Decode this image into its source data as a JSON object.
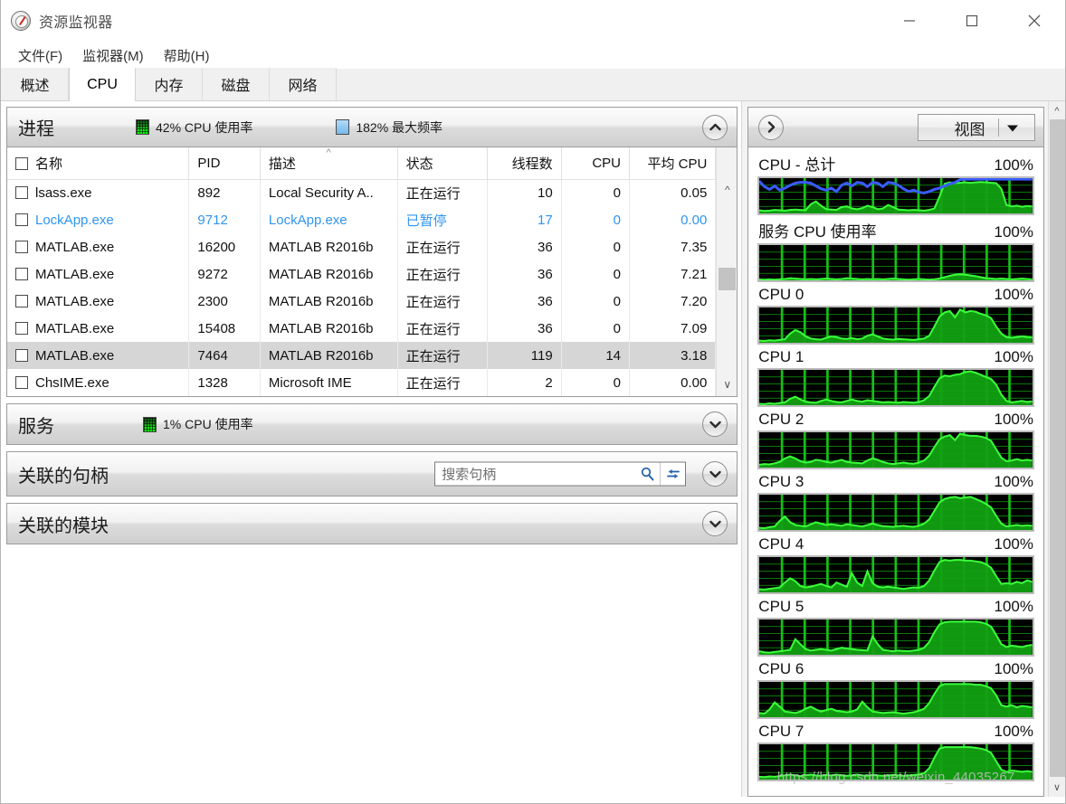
{
  "window": {
    "title": "资源监视器",
    "app_icon": "resource-monitor-icon",
    "controls": {
      "minimize": "minimize-icon",
      "maximize": "maximize-icon",
      "close": "close-icon"
    }
  },
  "menubar": {
    "items": [
      "文件(F)",
      "监视器(M)",
      "帮助(H)"
    ]
  },
  "tabs": {
    "items": [
      {
        "label": "概述",
        "active": false
      },
      {
        "label": "CPU",
        "active": true
      },
      {
        "label": "内存",
        "active": false
      },
      {
        "label": "磁盘",
        "active": false
      },
      {
        "label": "网络",
        "active": false
      }
    ]
  },
  "processes_section": {
    "title": "进程",
    "legend": [
      {
        "swatch": "green",
        "text": "42% CPU 使用率"
      },
      {
        "swatch": "blue",
        "text": "182% 最大频率"
      }
    ],
    "collapse_icon": "chevron-up-icon",
    "columns": [
      {
        "key": "name",
        "label": "名称",
        "align": "l"
      },
      {
        "key": "pid",
        "label": "PID",
        "align": "l"
      },
      {
        "key": "desc",
        "label": "描述",
        "align": "l",
        "sorted": "asc"
      },
      {
        "key": "status",
        "label": "状态",
        "align": "l"
      },
      {
        "key": "threads",
        "label": "线程数",
        "align": "r"
      },
      {
        "key": "cpu",
        "label": "CPU",
        "align": "r"
      },
      {
        "key": "avgcpu",
        "label": "平均 CPU",
        "align": "r"
      }
    ],
    "rows": [
      {
        "name": "lsass.exe",
        "pid": "892",
        "desc": "Local Security A..",
        "status": "正在运行",
        "threads": "10",
        "cpu": "0",
        "avgcpu": "0.05",
        "state": "normal"
      },
      {
        "name": "LockApp.exe",
        "pid": "9712",
        "desc": "LockApp.exe",
        "status": "已暂停",
        "threads": "17",
        "cpu": "0",
        "avgcpu": "0.00",
        "state": "suspended"
      },
      {
        "name": "MATLAB.exe",
        "pid": "16200",
        "desc": "MATLAB R2016b",
        "status": "正在运行",
        "threads": "36",
        "cpu": "0",
        "avgcpu": "7.35",
        "state": "normal"
      },
      {
        "name": "MATLAB.exe",
        "pid": "9272",
        "desc": "MATLAB R2016b",
        "status": "正在运行",
        "threads": "36",
        "cpu": "0",
        "avgcpu": "7.21",
        "state": "normal"
      },
      {
        "name": "MATLAB.exe",
        "pid": "2300",
        "desc": "MATLAB R2016b",
        "status": "正在运行",
        "threads": "36",
        "cpu": "0",
        "avgcpu": "7.20",
        "state": "normal"
      },
      {
        "name": "MATLAB.exe",
        "pid": "15408",
        "desc": "MATLAB R2016b",
        "status": "正在运行",
        "threads": "36",
        "cpu": "0",
        "avgcpu": "7.09",
        "state": "normal"
      },
      {
        "name": "MATLAB.exe",
        "pid": "7464",
        "desc": "MATLAB R2016b",
        "status": "正在运行",
        "threads": "119",
        "cpu": "14",
        "avgcpu": "3.18",
        "state": "selected"
      },
      {
        "name": "ChsIME.exe",
        "pid": "1328",
        "desc": "Microsoft IME",
        "status": "正在运行",
        "threads": "2",
        "cpu": "0",
        "avgcpu": "0.00",
        "state": "normal"
      }
    ]
  },
  "services_section": {
    "title": "服务",
    "legend": [
      {
        "swatch": "green",
        "text": "1% CPU 使用率"
      }
    ],
    "expand_icon": "chevron-down-icon"
  },
  "handles_section": {
    "title": "关联的句柄",
    "search_placeholder": "搜索句柄",
    "search_value": "",
    "search_icon": "search-icon",
    "refresh_icon": "refresh-arrows-icon",
    "expand_icon": "chevron-down-icon"
  },
  "modules_section": {
    "title": "关联的模块",
    "expand_icon": "chevron-down-icon"
  },
  "graph_panel": {
    "expand_icon": "chevron-right-icon",
    "view_label": "视图",
    "dropdown_icon": "triangle-down-icon"
  },
  "watermark": "https://blog.csdn.net/weixin_44035267",
  "chart_data": [
    {
      "type": "area",
      "title": "CPU - 总计",
      "scale_label": "100%",
      "ylim": [
        0,
        100
      ],
      "grid": true,
      "series": [
        {
          "name": "CPU 使用率",
          "color": "#00e000",
          "values": [
            9,
            7,
            8,
            10,
            9,
            8,
            10,
            11,
            10,
            9,
            26,
            34,
            22,
            12,
            11,
            10,
            18,
            20,
            14,
            12,
            15,
            22,
            18,
            12,
            14,
            24,
            18,
            11,
            10,
            9,
            10,
            9,
            8,
            10,
            14,
            48,
            84,
            88,
            86,
            87,
            88,
            87,
            88,
            89,
            88,
            87,
            86,
            70,
            24,
            20,
            22,
            19,
            21,
            20
          ]
        },
        {
          "name": "最大频率",
          "color": "#3a5cff",
          "values": [
            92,
            76,
            68,
            78,
            66,
            72,
            80,
            86,
            88,
            88,
            86,
            78,
            70,
            66,
            72,
            62,
            80,
            86,
            78,
            88,
            86,
            76,
            88,
            86,
            76,
            88,
            86,
            80,
            70,
            62,
            66,
            60,
            58,
            62,
            68,
            72,
            78,
            84,
            88,
            96,
            97,
            97,
            97,
            97,
            97,
            97,
            97,
            97,
            97,
            97,
            97,
            97,
            97,
            97
          ]
        }
      ]
    },
    {
      "type": "area",
      "title": "服务 CPU 使用率",
      "scale_label": "100%",
      "ylim": [
        0,
        100
      ],
      "grid": true,
      "series": [
        {
          "name": "服务 CPU",
          "color": "#00e000",
          "values": [
            3,
            2,
            3,
            2,
            3,
            4,
            6,
            5,
            4,
            3,
            4,
            3,
            4,
            5,
            4,
            3,
            4,
            6,
            5,
            4,
            3,
            4,
            3,
            4,
            3,
            4,
            5,
            4,
            3,
            2,
            3,
            4,
            3,
            2,
            3,
            5,
            9,
            13,
            16,
            17,
            16,
            14,
            12,
            9,
            6,
            5,
            4,
            5,
            4,
            3,
            4,
            5,
            4,
            3
          ]
        }
      ]
    },
    {
      "type": "area",
      "title": "CPU 0",
      "scale_label": "100%",
      "ylim": [
        0,
        100
      ],
      "grid": true,
      "series": [
        {
          "name": "CPU 0",
          "color": "#00e000",
          "values": [
            6,
            5,
            7,
            6,
            8,
            10,
            26,
            36,
            30,
            18,
            12,
            10,
            9,
            14,
            18,
            16,
            12,
            11,
            13,
            10,
            12,
            20,
            24,
            18,
            12,
            10,
            9,
            11,
            10,
            9,
            8,
            10,
            12,
            20,
            46,
            74,
            86,
            90,
            72,
            94,
            86,
            90,
            88,
            82,
            78,
            70,
            46,
            26,
            16,
            14,
            16,
            18,
            16,
            15
          ]
        }
      ]
    },
    {
      "type": "area",
      "title": "CPU 1",
      "scale_label": "100%",
      "ylim": [
        0,
        100
      ],
      "grid": true,
      "series": [
        {
          "name": "CPU 1",
          "color": "#00e000",
          "values": [
            4,
            3,
            5,
            4,
            6,
            8,
            18,
            24,
            16,
            10,
            8,
            7,
            12,
            16,
            12,
            9,
            8,
            12,
            16,
            12,
            10,
            14,
            12,
            10,
            8,
            9,
            8,
            7,
            9,
            8,
            7,
            9,
            14,
            26,
            52,
            76,
            84,
            82,
            86,
            88,
            94,
            96,
            92,
            86,
            80,
            74,
            58,
            30,
            12,
            8,
            10,
            12,
            9,
            11
          ]
        }
      ]
    },
    {
      "type": "area",
      "title": "CPU 2",
      "scale_label": "100%",
      "ylim": [
        0,
        100
      ],
      "grid": true,
      "series": [
        {
          "name": "CPU 2",
          "color": "#00e000",
          "values": [
            8,
            10,
            9,
            12,
            16,
            26,
            32,
            26,
            18,
            14,
            16,
            22,
            20,
            16,
            14,
            18,
            22,
            16,
            14,
            13,
            12,
            20,
            26,
            22,
            16,
            12,
            10,
            12,
            14,
            12,
            11,
            14,
            20,
            34,
            58,
            80,
            88,
            92,
            78,
            96,
            92,
            90,
            90,
            88,
            84,
            76,
            52,
            28,
            18,
            20,
            24,
            20,
            22,
            20
          ]
        }
      ]
    },
    {
      "type": "area",
      "title": "CPU 3",
      "scale_label": "100%",
      "ylim": [
        0,
        100
      ],
      "grid": true,
      "series": [
        {
          "name": "CPU 3",
          "color": "#00e000",
          "values": [
            6,
            5,
            8,
            10,
            26,
            38,
            22,
            14,
            12,
            10,
            16,
            22,
            18,
            14,
            16,
            14,
            12,
            16,
            14,
            12,
            10,
            14,
            18,
            14,
            11,
            10,
            9,
            11,
            12,
            10,
            9,
            12,
            18,
            30,
            54,
            78,
            88,
            92,
            94,
            90,
            92,
            94,
            88,
            82,
            74,
            64,
            40,
            18,
            10,
            12,
            14,
            12,
            13,
            12
          ]
        }
      ]
    },
    {
      "type": "area",
      "title": "CPU 4",
      "scale_label": "100%",
      "ylim": [
        0,
        100
      ],
      "grid": true,
      "series": [
        {
          "name": "CPU 4",
          "color": "#00e000",
          "values": [
            9,
            8,
            10,
            12,
            14,
            28,
            40,
            32,
            18,
            14,
            16,
            20,
            24,
            18,
            14,
            28,
            22,
            16,
            54,
            28,
            18,
            60,
            26,
            16,
            14,
            16,
            14,
            12,
            10,
            12,
            14,
            13,
            18,
            34,
            62,
            86,
            92,
            90,
            92,
            92,
            90,
            90,
            88,
            86,
            80,
            70,
            46,
            24,
            26,
            24,
            30,
            26,
            34,
            30
          ]
        }
      ]
    },
    {
      "type": "area",
      "title": "CPU 5",
      "scale_label": "100%",
      "ylim": [
        0,
        100
      ],
      "grid": true,
      "series": [
        {
          "name": "CPU 5",
          "color": "#00e000",
          "values": [
            10,
            7,
            6,
            8,
            10,
            12,
            14,
            44,
            30,
            16,
            12,
            14,
            16,
            14,
            12,
            16,
            20,
            18,
            16,
            14,
            13,
            12,
            52,
            30,
            14,
            12,
            10,
            12,
            11,
            10,
            12,
            14,
            20,
            36,
            64,
            86,
            92,
            94,
            94,
            94,
            94,
            94,
            94,
            92,
            88,
            80,
            56,
            30,
            22,
            26,
            24,
            22,
            26,
            28
          ]
        }
      ]
    },
    {
      "type": "area",
      "title": "CPU 6",
      "scale_label": "100%",
      "ylim": [
        0,
        100
      ],
      "grid": true,
      "series": [
        {
          "name": "CPU 6",
          "color": "#00e000",
          "values": [
            12,
            10,
            22,
            42,
            30,
            16,
            14,
            12,
            16,
            24,
            30,
            22,
            16,
            20,
            24,
            18,
            16,
            14,
            16,
            22,
            44,
            28,
            16,
            14,
            12,
            13,
            14,
            12,
            10,
            12,
            14,
            18,
            24,
            40,
            66,
            88,
            94,
            94,
            94,
            94,
            94,
            94,
            92,
            92,
            88,
            82,
            62,
            34,
            30,
            34,
            28,
            32,
            30,
            28
          ]
        }
      ]
    },
    {
      "type": "area",
      "title": "CPU 7",
      "scale_label": "100%",
      "ylim": [
        0,
        100
      ],
      "grid": true,
      "series": [
        {
          "name": "CPU 7",
          "color": "#00e000",
          "values": [
            8,
            7,
            9,
            8,
            10,
            12,
            14,
            12,
            10,
            12,
            14,
            12,
            11,
            13,
            12,
            14,
            12,
            11,
            12,
            14,
            12,
            11,
            13,
            12,
            11,
            12,
            13,
            12,
            11,
            12,
            13,
            14,
            18,
            32,
            62,
            88,
            92,
            92,
            92,
            92,
            92,
            92,
            90,
            88,
            84,
            76,
            52,
            28,
            22,
            26,
            24,
            22,
            24,
            22
          ]
        }
      ]
    }
  ]
}
